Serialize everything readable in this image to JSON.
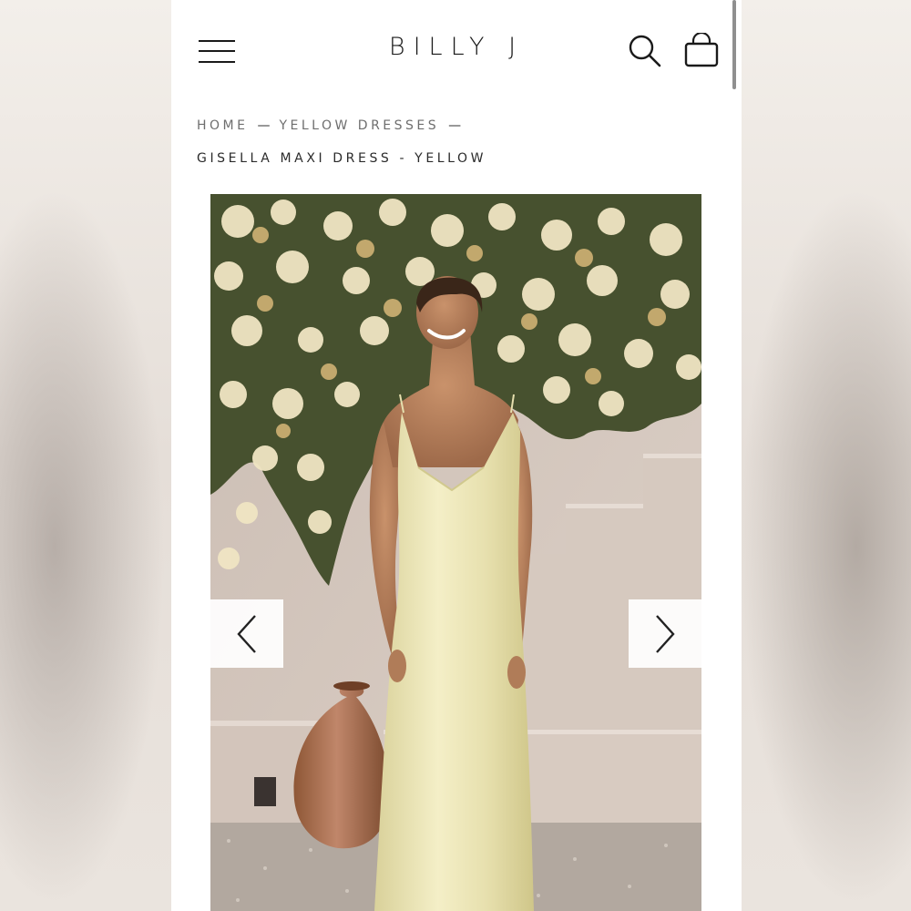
{
  "brand": {
    "logo_text": "BILLY J"
  },
  "header": {
    "menu_icon": "hamburger-menu-icon",
    "search_icon": "search-icon",
    "bag_icon": "shopping-bag-icon"
  },
  "breadcrumb": {
    "items": [
      "HOME",
      "YELLOW DRESSES"
    ],
    "separator": "—",
    "current": "GISELLA MAXI DRESS - YELLOW"
  },
  "gallery": {
    "prev_icon": "chevron-left-icon",
    "next_icon": "chevron-right-icon"
  },
  "colors": {
    "dress": "#efe9b9",
    "wall": "#d9ccc3",
    "foliage": "#4a5436",
    "flowers": "#f1e7c4"
  }
}
